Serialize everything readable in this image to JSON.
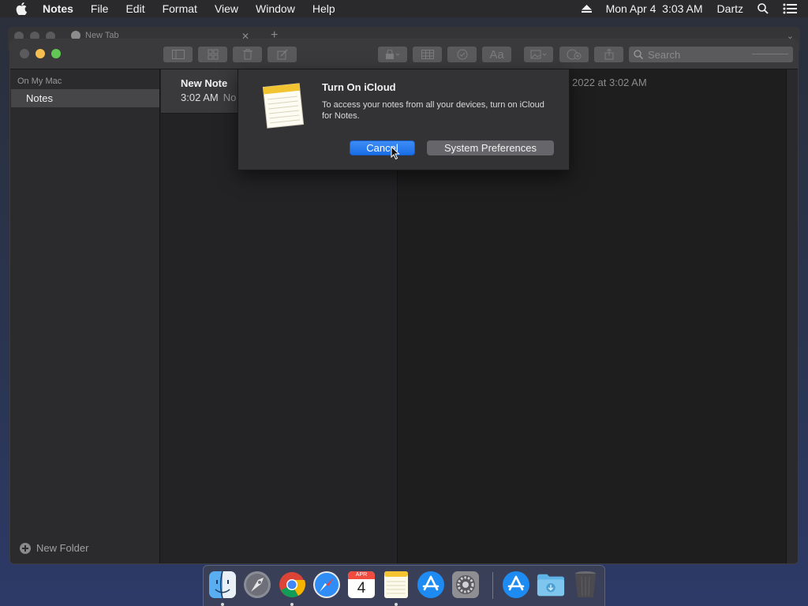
{
  "menubar": {
    "app_name": "Notes",
    "items": [
      "File",
      "Edit",
      "Format",
      "View",
      "Window",
      "Help"
    ],
    "datetime": "Mon Apr 4  3:03 AM",
    "user": "Dartz"
  },
  "browser_behind": {
    "tab_label": "New Tab"
  },
  "window": {
    "search_placeholder": "Search"
  },
  "sidebar": {
    "section": "On My Mac",
    "selected_folder": "Notes",
    "new_folder_label": "New Folder"
  },
  "notelist": {
    "title": "New Note",
    "time": "3:02 AM",
    "preview": "No"
  },
  "editor": {
    "date_partial": "2022 at 3:02 AM"
  },
  "dialog": {
    "title": "Turn On iCloud",
    "message": "To access your notes from all your devices, turn on iCloud for Notes.",
    "cancel_label": "Cancel",
    "sysprefs_label": "System Preferences"
  },
  "dock": {
    "calendar_month": "APR",
    "calendar_day": "4",
    "apps": [
      "finder-icon",
      "launchpad-icon",
      "chrome-icon",
      "safari-icon",
      "calendar-icon",
      "notes-icon",
      "app-store-icon",
      "system-preferences-icon",
      "app-store-icon",
      "downloads-folder-icon",
      "trash-icon"
    ]
  },
  "colors": {
    "accent_blue": "#1a6ee6",
    "traffic_yellow": "#f6be4f",
    "traffic_green": "#62c655"
  }
}
